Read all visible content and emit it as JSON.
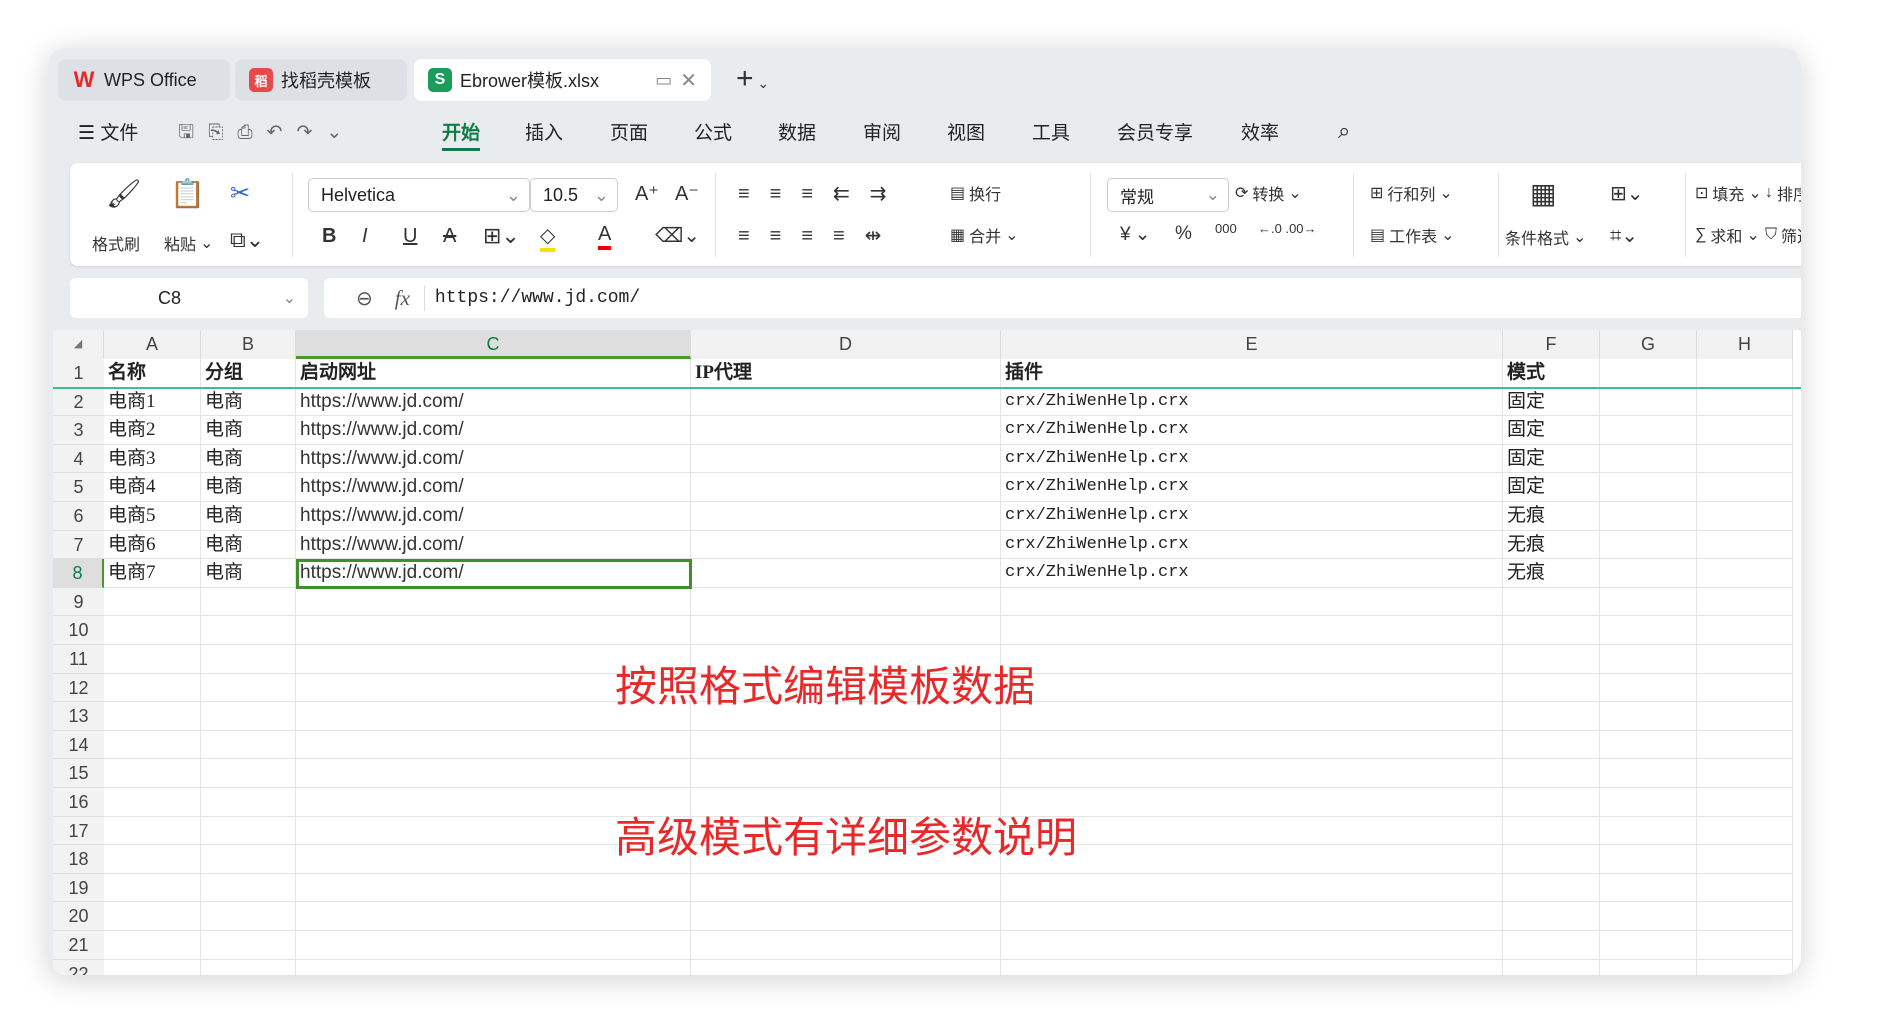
{
  "tabs": [
    {
      "label": "WPS Office",
      "icon": "W",
      "color": "#e8292a"
    },
    {
      "label": "找稻壳模板",
      "icon": "稻",
      "color": "#e84a4a"
    },
    {
      "label": "Ebrower模板.xlsx",
      "icon": "S",
      "color": "#1a9c5a"
    }
  ],
  "menu": {
    "file": "文件",
    "items": [
      "开始",
      "插入",
      "页面",
      "公式",
      "数据",
      "审阅",
      "视图",
      "工具",
      "会员专享",
      "效率"
    ]
  },
  "ribbon": {
    "format_painter": "格式刷",
    "paste": "粘贴",
    "font": "Helvetica",
    "size": "10.5",
    "wrap": "换行",
    "merge": "合并",
    "number_format": "常规",
    "convert": "转换",
    "rows_cols": "行和列",
    "worksheet": "工作表",
    "cond_format": "条件格式",
    "fill": "填充",
    "sum": "求和",
    "sort": "排序",
    "filter": "筛选",
    "currency": "¥",
    "percent": "%",
    "thousands": "000"
  },
  "formula_bar": {
    "cell_ref": "C8",
    "fx": "fx",
    "value": "https://www.jd.com/"
  },
  "columns": [
    "A",
    "B",
    "C",
    "D",
    "E",
    "F",
    "G",
    "H"
  ],
  "selected_col": "C",
  "selected_row": 8,
  "rows": [
    [
      "名称",
      "分组",
      "启动网址",
      "IP代理",
      "插件",
      "模式"
    ],
    [
      "电商1",
      "电商",
      "https://www.jd.com/",
      "",
      "crx/ZhiWenHelp.crx",
      "固定"
    ],
    [
      "电商2",
      "电商",
      "https://www.jd.com/",
      "",
      "crx/ZhiWenHelp.crx",
      "固定"
    ],
    [
      "电商3",
      "电商",
      "https://www.jd.com/",
      "",
      "crx/ZhiWenHelp.crx",
      "固定"
    ],
    [
      "电商4",
      "电商",
      "https://www.jd.com/",
      "",
      "crx/ZhiWenHelp.crx",
      "固定"
    ],
    [
      "电商5",
      "电商",
      "https://www.jd.com/",
      "",
      "crx/ZhiWenHelp.crx",
      "无痕"
    ],
    [
      "电商6",
      "电商",
      "https://www.jd.com/",
      "",
      "crx/ZhiWenHelp.crx",
      "无痕"
    ],
    [
      "电商7",
      "电商",
      "https://www.jd.com/",
      "",
      "crx/ZhiWenHelp.crx",
      "无痕"
    ]
  ],
  "row_count": 22,
  "notes": [
    "按照格式编辑模板数据",
    "高级模式有详细参数说明"
  ],
  "colors": {
    "accent": "#0f7b45",
    "note": "#e8292a"
  }
}
